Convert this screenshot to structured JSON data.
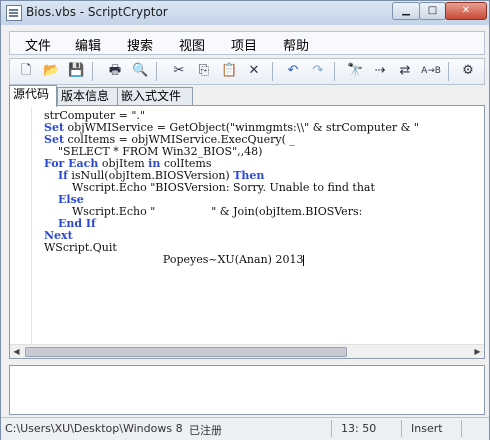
{
  "window": {
    "title": "Bios.vbs - ScriptCryptor",
    "minimize_glyph": "▁",
    "maximize_glyph": "□",
    "close_glyph": "✕"
  },
  "menu": [
    "文件",
    "编辑",
    "搜索",
    "视图",
    "项目",
    "帮助"
  ],
  "toolbar": {
    "icons": {
      "new": "🗋",
      "open": "📂",
      "save": "💾",
      "print": "🖶",
      "print_preview": "🔍",
      "cut": "✂",
      "copy": "⎘",
      "paste": "📋",
      "delete": "✕",
      "undo": "↶",
      "redo": "↷",
      "find": "🔭",
      "find_next": "⇢",
      "replace": "⇄",
      "replace_ab": "A→B",
      "build": "⚙"
    }
  },
  "tabs": [
    "源代码",
    "版本信息",
    "嵌入式文件"
  ],
  "code_lines": [
    [
      {
        "t": "strComputer = \".\""
      }
    ],
    [
      {
        "t": "Set",
        "k": 1
      },
      {
        "t": " objWMIService = GetObject(\"winmgmts:\\\\\" & strComputer & \""
      }
    ],
    [
      {
        "t": "Set",
        "k": 1
      },
      {
        "t": " colItems = objWMIService.ExecQuery( _"
      }
    ],
    [
      {
        "t": "    \"SELECT * FROM Win32_BIOS\",,48)"
      }
    ],
    [
      {
        "t": "For Each",
        "k": 1
      },
      {
        "t": " objItem "
      },
      {
        "t": "in",
        "k": 1
      },
      {
        "t": " colItems"
      }
    ],
    [
      {
        "t": "    "
      },
      {
        "t": "If",
        "k": 1
      },
      {
        "t": " isNull(objItem.BIOSVersion) "
      },
      {
        "t": "Then",
        "k": 1
      }
    ],
    [
      {
        "t": "        Wscript.Echo \"BIOSVersion: Sorry. Unable to find that"
      }
    ],
    [
      {
        "t": "    "
      },
      {
        "t": "Else",
        "k": 1
      }
    ],
    [
      {
        "t": "        Wscript.Echo \"                \" & Join(objItem.BIOSVers:"
      }
    ],
    [
      {
        "t": "    "
      },
      {
        "t": "End If",
        "k": 1
      }
    ],
    [
      {
        "t": "Next",
        "k": 1
      }
    ],
    [
      {
        "t": "WScript.Quit"
      }
    ],
    [
      {
        "t": "                                  Popeyes~XU(Anan) 2013"
      }
    ]
  ],
  "status": {
    "path": "C:\\Users\\XU\\Desktop\\Windows 8 Acti",
    "registered": "已注册",
    "position": "13: 50",
    "mode": "Insert"
  }
}
